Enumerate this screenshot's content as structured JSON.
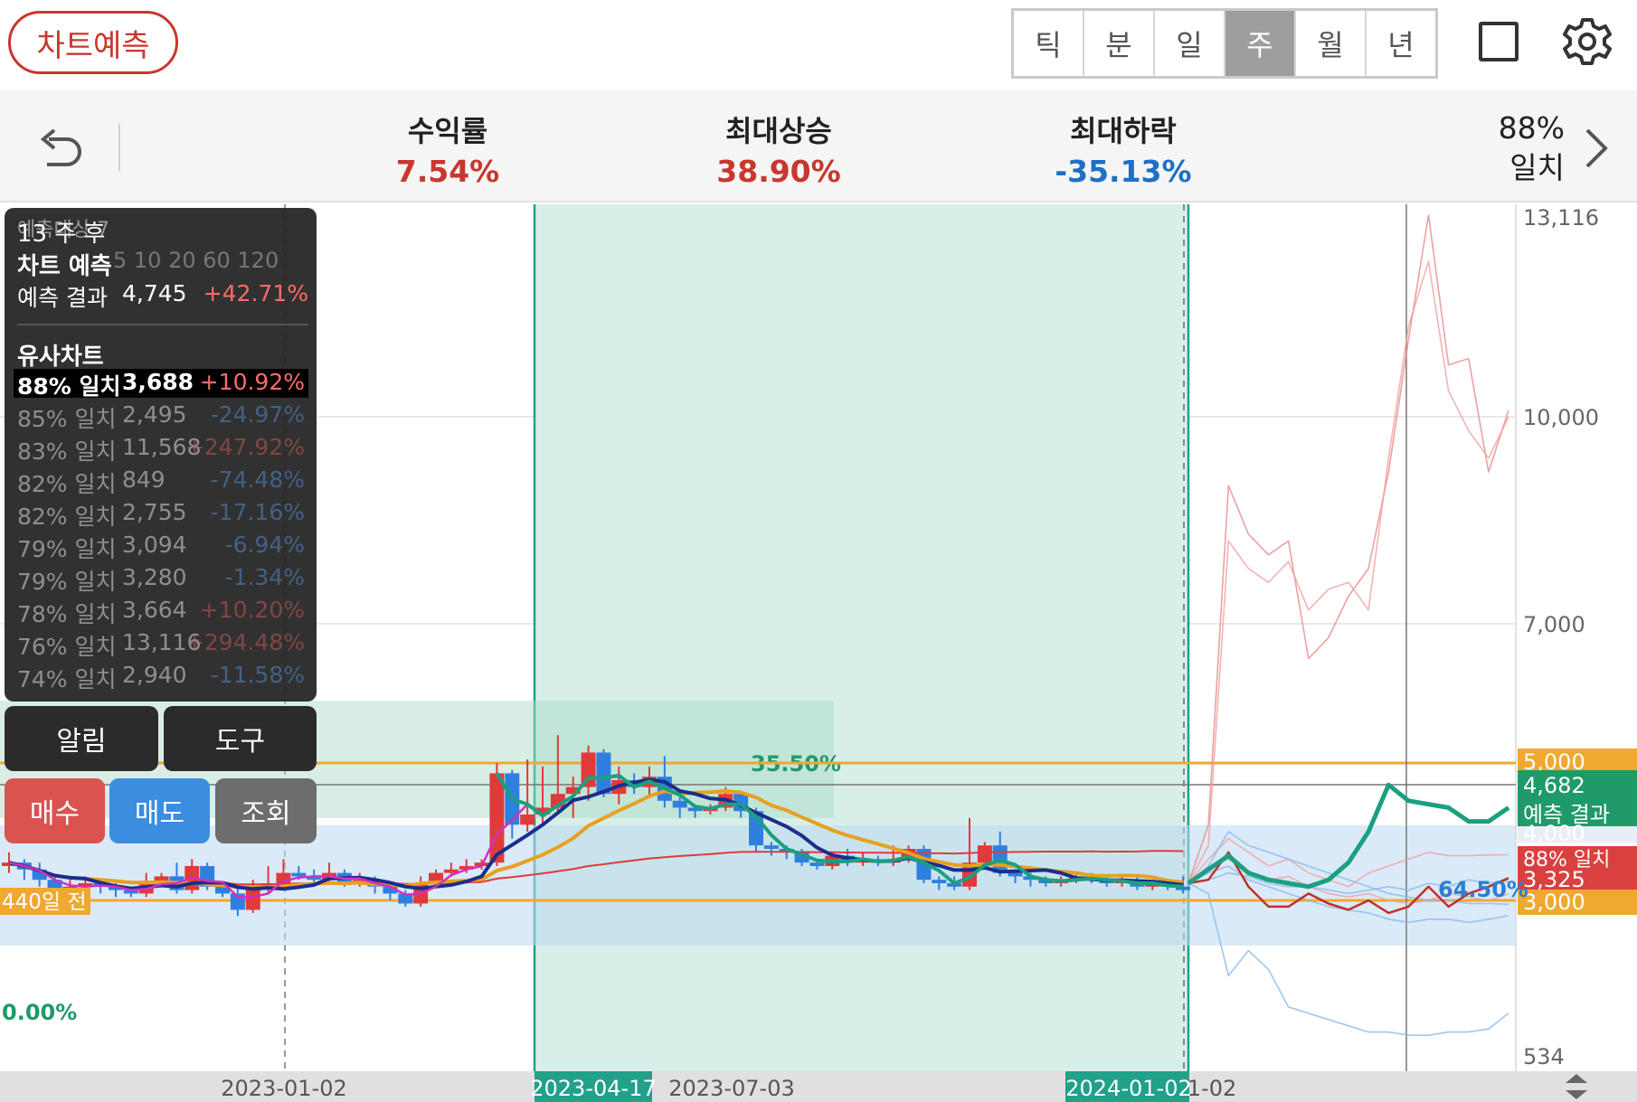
{
  "header": {
    "predict_button": "차트예측",
    "periods": [
      "틱",
      "분",
      "일",
      "주",
      "월",
      "년"
    ],
    "active_period_index": 3,
    "icons": [
      "square-icon",
      "gear-icon"
    ]
  },
  "stats": {
    "return": {
      "label": "수익률",
      "value": "7.54%",
      "color": "#c8372d"
    },
    "max_rise": {
      "label": "최대상승",
      "value": "38.90%",
      "color": "#c8372d"
    },
    "max_drop": {
      "label": "최대하락",
      "value": "-35.13%",
      "color": "#1f6fc4"
    },
    "match_percent": "88%",
    "match_label": "일치"
  },
  "panel": {
    "weeks_after": "13 주 후",
    "prediction_title": "차트 예측",
    "prediction_result": {
      "label": "예측 결과",
      "value": "4,745",
      "pct": "+42.71%"
    },
    "similar_title": "유사차트",
    "similar": [
      {
        "match": "88% 일치",
        "value": "3,688",
        "pct": "+10.92%",
        "selected": true
      },
      {
        "match": "85% 일치",
        "value": "2,495",
        "pct": "-24.97%"
      },
      {
        "match": "83% 일치",
        "value": "11,568",
        "pct": "+247.92%"
      },
      {
        "match": "82% 일치",
        "value": "849",
        "pct": "-74.48%"
      },
      {
        "match": "82% 일치",
        "value": "2,755",
        "pct": "-17.16%"
      },
      {
        "match": "79% 일치",
        "value": "3,094",
        "pct": "-6.94%"
      },
      {
        "match": "79% 일치",
        "value": "3,280",
        "pct": "-1.34%"
      },
      {
        "match": "78% 일치",
        "value": "3,664",
        "pct": "+10.20%"
      },
      {
        "match": "76% 일치",
        "value": "13,116",
        "pct": "+294.48%"
      },
      {
        "match": "74% 일치",
        "value": "2,940",
        "pct": "-11.58%"
      }
    ],
    "ghost_text": {
      "top": "예측대상 7",
      "ma_legend": "5 10 20 60 120",
      "day_label": "440일 전"
    }
  },
  "buttons": {
    "alert": "알림",
    "tool": "도구",
    "buy": "매수",
    "sell": "매도",
    "inquiry": "조회"
  },
  "chart_labels": {
    "pct_box": "35.50%",
    "pct_right": "64.50%",
    "pct_zero": "0.00%",
    "days_before": "440일 전",
    "axis_dates": [
      "2023-01-02",
      "2023-04-17",
      "2023-07-03",
      "2024-01-02",
      "1-02"
    ],
    "y_ticks": [
      "13,116",
      "10,000",
      "7,000",
      "4,000",
      "534"
    ],
    "price_tags": {
      "line_5000": "5,000",
      "line_3000": "3,000",
      "current": "4,682",
      "prediction": "예측 결과",
      "match88": "88% 일치",
      "match_value": "3,325"
    }
  },
  "chart_data": {
    "type": "candlestick",
    "ylim": [
      534,
      13116
    ],
    "y_ticks": [
      13116,
      10000,
      7000,
      4000,
      534
    ],
    "reference_lines": [
      5000,
      3000
    ],
    "x_dates": [
      "2023-01-02",
      "2023-04-17",
      "2023-07-03",
      "2024-01-02"
    ],
    "candles": [
      [
        3500,
        3550,
        3700,
        3400
      ],
      [
        3550,
        3450,
        3600,
        3300
      ],
      [
        3450,
        3300,
        3550,
        3200
      ],
      [
        3300,
        3150,
        3350,
        2950
      ],
      [
        3150,
        3200,
        3300,
        3100
      ],
      [
        3200,
        3250,
        3350,
        3150
      ],
      [
        3250,
        3200,
        3300,
        3100
      ],
      [
        3200,
        3150,
        3250,
        3050
      ],
      [
        3150,
        3100,
        3200,
        3050
      ],
      [
        3100,
        3250,
        3400,
        3050
      ],
      [
        3250,
        3350,
        3400,
        3200
      ],
      [
        3350,
        3150,
        3550,
        3100
      ],
      [
        3150,
        3500,
        3600,
        3100
      ],
      [
        3500,
        3200,
        3550,
        3150
      ],
      [
        3200,
        3100,
        3250,
        3050
      ],
      [
        3100,
        2850,
        3200,
        2750
      ],
      [
        2850,
        3200,
        3300,
        2800
      ],
      [
        3200,
        3250,
        3500,
        3100
      ],
      [
        3250,
        3400,
        3600,
        3200
      ],
      [
        3400,
        3350,
        3500,
        3300
      ],
      [
        3350,
        3300,
        3450,
        3200
      ],
      [
        3300,
        3400,
        3550,
        3250
      ],
      [
        3400,
        3250,
        3450,
        3200
      ],
      [
        3250,
        3300,
        3400,
        3200
      ],
      [
        3300,
        3200,
        3350,
        3100
      ],
      [
        3200,
        3100,
        3250,
        3000
      ],
      [
        3100,
        2950,
        3150,
        2900
      ],
      [
        2950,
        3250,
        3350,
        2900
      ],
      [
        3250,
        3400,
        3450,
        3200
      ],
      [
        3400,
        3450,
        3550,
        3350
      ],
      [
        3450,
        3500,
        3600,
        3400
      ],
      [
        3500,
        3550,
        3600,
        3450
      ],
      [
        3550,
        4850,
        5000,
        3500
      ],
      [
        4850,
        4100,
        4900,
        3900
      ],
      [
        4100,
        4250,
        5050,
        4000
      ],
      [
        4250,
        4350,
        4950,
        4100
      ],
      [
        4350,
        4550,
        5400,
        4300
      ],
      [
        4550,
        4650,
        4800,
        4200
      ],
      [
        4650,
        5150,
        5250,
        4450
      ],
      [
        5150,
        4550,
        5200,
        4500
      ],
      [
        4550,
        4750,
        4950,
        4400
      ],
      [
        4750,
        4650,
        4850,
        4550
      ],
      [
        4650,
        4800,
        4950,
        4500
      ],
      [
        4800,
        4450,
        5100,
        4350
      ],
      [
        4450,
        4350,
        4500,
        4200
      ],
      [
        4350,
        4300,
        4400,
        4200
      ],
      [
        4300,
        4350,
        4400,
        4250
      ],
      [
        4350,
        4550,
        4650,
        4300
      ],
      [
        4550,
        4300,
        4600,
        4200
      ],
      [
        4300,
        3800,
        4350,
        3700
      ],
      [
        3800,
        3750,
        3850,
        3650
      ],
      [
        3750,
        3700,
        3800,
        3600
      ],
      [
        3700,
        3550,
        3750,
        3500
      ],
      [
        3550,
        3500,
        3600,
        3450
      ],
      [
        3500,
        3650,
        3700,
        3450
      ],
      [
        3650,
        3550,
        3750,
        3500
      ],
      [
        3550,
        3600,
        3700,
        3500
      ],
      [
        3600,
        3550,
        3650,
        3500
      ],
      [
        3550,
        3600,
        3800,
        3500
      ],
      [
        3600,
        3750,
        3800,
        3550
      ],
      [
        3750,
        3300,
        3800,
        3250
      ],
      [
        3300,
        3250,
        3350,
        3150
      ],
      [
        3250,
        3200,
        3350,
        3150
      ],
      [
        3200,
        3550,
        4200,
        3150
      ],
      [
        3550,
        3800,
        3850,
        3500
      ],
      [
        3800,
        3400,
        4000,
        3350
      ],
      [
        3400,
        3350,
        3450,
        3250
      ],
      [
        3350,
        3300,
        3400,
        3200
      ],
      [
        3300,
        3250,
        3350,
        3200
      ],
      [
        3250,
        3300,
        3350,
        3200
      ],
      [
        3300,
        3350,
        3400,
        3250
      ],
      [
        3350,
        3300,
        3400,
        3250
      ],
      [
        3300,
        3250,
        3350,
        3200
      ],
      [
        3250,
        3300,
        3350,
        3200
      ],
      [
        3300,
        3200,
        3350,
        3150
      ],
      [
        3200,
        3250,
        3300,
        3150
      ],
      [
        3250,
        3200,
        3300,
        3150
      ],
      [
        3200,
        3150,
        3350,
        3100
      ]
    ],
    "prediction_line": [
      3250,
      3450,
      3650,
      3400,
      3300,
      3250,
      3200,
      3300,
      3550,
      4000,
      4682,
      4450,
      4400,
      4350,
      4150,
      4150,
      4350
    ],
    "match88_line": [
      3250,
      3300,
      3700,
      3200,
      2900,
      2900,
      3100,
      2950,
      2850,
      3000,
      2800,
      2900,
      3200,
      2900,
      3100,
      3200,
      3325
    ],
    "similar_lines": [
      [
        3250,
        4100,
        9000,
        8300,
        8000,
        8200,
        6500,
        6800,
        7400,
        7800,
        9200,
        11200,
        13116,
        10800,
        10900,
        9200,
        10100
      ],
      [
        3250,
        3800,
        8200,
        7800,
        7600,
        7900,
        7200,
        7500,
        7600,
        7200,
        9400,
        11400,
        12400,
        10400,
        9800,
        9400,
        10000
      ],
      [
        3250,
        3100,
        1800,
        2200,
        1900,
        1300,
        1200,
        1100,
        1000,
        900,
        900,
        850,
        849,
        900,
        900,
        950,
        1200
      ],
      [
        3250,
        3400,
        3500,
        3300,
        3200,
        3100,
        3000,
        2900,
        2850,
        2800,
        2700,
        2650,
        2700,
        2700,
        2650,
        2700,
        2755
      ],
      [
        3250,
        3500,
        3600,
        3400,
        3300,
        3350,
        3200,
        3100,
        3050,
        3100,
        3000,
        2950,
        3000,
        3100,
        3050,
        3000,
        3094
      ],
      [
        3250,
        3300,
        3400,
        3350,
        3250,
        3200,
        3200,
        3150,
        3100,
        3150,
        3200,
        3150,
        3250,
        3200,
        3300,
        3250,
        3280
      ],
      [
        3250,
        3600,
        3900,
        3700,
        3500,
        3600,
        3400,
        3300,
        3200,
        3400,
        3500,
        3600,
        3700,
        3650,
        3650,
        3660,
        3664
      ],
      [
        3250,
        3500,
        4000,
        3800,
        3700,
        3600,
        3500,
        3400,
        3300,
        3200,
        3100,
        3050,
        3000,
        3000,
        2950,
        2950,
        2940
      ]
    ]
  }
}
